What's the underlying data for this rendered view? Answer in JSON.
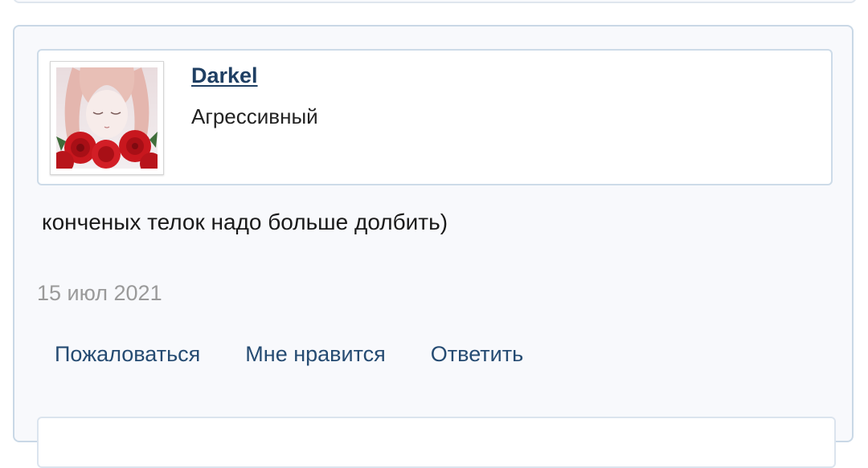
{
  "post": {
    "author": {
      "name": "Darkel",
      "title": "Агрессивный",
      "avatar_icon": "anime-girl-roses-avatar"
    },
    "message": "конченых телок надо больше долбить)",
    "date": "15 июл 2021",
    "actions": {
      "report": "Пожаловаться",
      "like": "Мне нравится",
      "reply": "Ответить"
    }
  },
  "colors": {
    "link": "#1f3f63",
    "action": "#254b72",
    "border": "#c9d8e6",
    "card_bg": "#f8f9fc",
    "date": "#9a9a9a"
  }
}
